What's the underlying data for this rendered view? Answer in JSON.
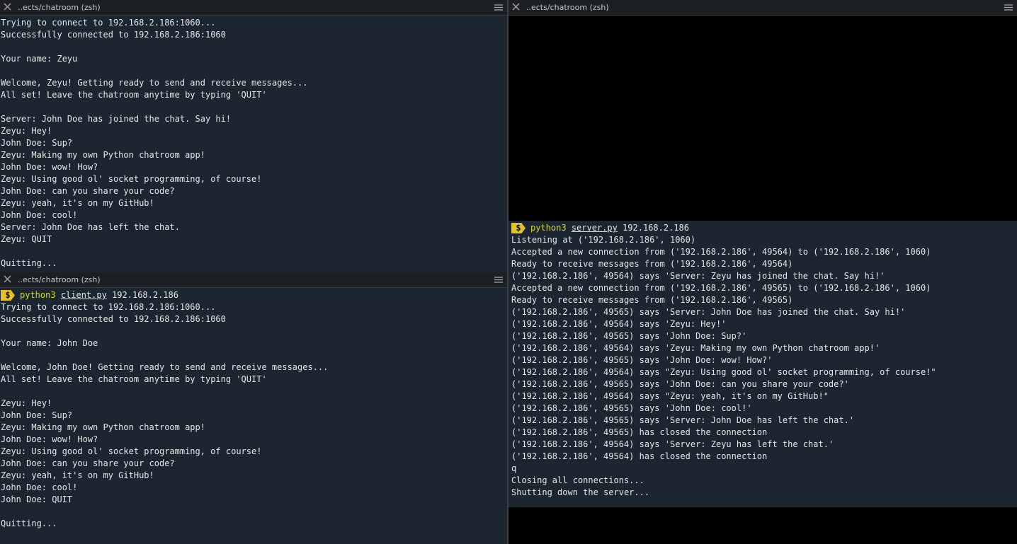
{
  "panes": {
    "top_left": {
      "title": "..ects/chatroom (zsh)",
      "lines": [
        "Trying to connect to 192.168.2.186:1060...",
        "Successfully connected to 192.168.2.186:1060",
        "",
        "Your name: Zeyu",
        "",
        "Welcome, Zeyu! Getting ready to send and receive messages...",
        "All set! Leave the chatroom anytime by typing 'QUIT'",
        "",
        "Server: John Doe has joined the chat. Say hi!",
        "Zeyu: Hey!",
        "John Doe: Sup?",
        "Zeyu: Making my own Python chatroom app!",
        "John Doe: wow! How?",
        "Zeyu: Using good ol' socket programming, of course!",
        "John Doe: can you share your code?",
        "Zeyu: yeah, it's on my GitHub!",
        "John Doe: cool!",
        "Server: John Doe has left the chat.",
        "Zeyu: QUIT",
        "",
        "Quitting..."
      ]
    },
    "bottom_left": {
      "title": "..ects/chatroom (zsh)",
      "prompt": {
        "symbol": "$",
        "command": "python3",
        "script": "client.py",
        "args": "192.168.2.186"
      },
      "lines": [
        "Trying to connect to 192.168.2.186:1060...",
        "Successfully connected to 192.168.2.186:1060",
        "",
        "Your name: John Doe",
        "",
        "Welcome, John Doe! Getting ready to send and receive messages...",
        "All set! Leave the chatroom anytime by typing 'QUIT'",
        "",
        "Zeyu: Hey!",
        "John Doe: Sup?",
        "Zeyu: Making my own Python chatroom app!",
        "John Doe: wow! How?",
        "Zeyu: Using good ol' socket programming, of course!",
        "John Doe: can you share your code?",
        "Zeyu: yeah, it's on my GitHub!",
        "John Doe: cool!",
        "John Doe: QUIT",
        "",
        "Quitting..."
      ]
    },
    "right": {
      "title": "..ects/chatroom (zsh)",
      "prompt": {
        "symbol": "$",
        "command": "python3",
        "script": "server.py",
        "args": "192.168.2.186"
      },
      "lines": [
        "Listening at ('192.168.2.186', 1060)",
        "Accepted a new connection from ('192.168.2.186', 49564) to ('192.168.2.186', 1060)",
        "Ready to receive messages from ('192.168.2.186', 49564)",
        "('192.168.2.186', 49564) says 'Server: Zeyu has joined the chat. Say hi!'",
        "Accepted a new connection from ('192.168.2.186', 49565) to ('192.168.2.186', 1060)",
        "Ready to receive messages from ('192.168.2.186', 49565)",
        "('192.168.2.186', 49565) says 'Server: John Doe has joined the chat. Say hi!'",
        "('192.168.2.186', 49564) says 'Zeyu: Hey!'",
        "('192.168.2.186', 49565) says 'John Doe: Sup?'",
        "('192.168.2.186', 49564) says 'Zeyu: Making my own Python chatroom app!'",
        "('192.168.2.186', 49565) says 'John Doe: wow! How?'",
        "('192.168.2.186', 49564) says \"Zeyu: Using good ol' socket programming, of course!\"",
        "('192.168.2.186', 49565) says 'John Doe: can you share your code?'",
        "('192.168.2.186', 49564) says \"Zeyu: yeah, it's on my GitHub!\"",
        "('192.168.2.186', 49565) says 'John Doe: cool!'",
        "('192.168.2.186', 49565) says 'Server: John Doe has left the chat.'",
        "('192.168.2.186', 49565) has closed the connection",
        "('192.168.2.186', 49564) says 'Server: Zeyu has left the chat.'",
        "('192.168.2.186', 49564) has closed the connection",
        "q",
        "Closing all connections...",
        "Shutting down the server..."
      ]
    }
  },
  "icons": {
    "close": "close-icon",
    "menu": "hamburger-menu-icon",
    "prompt": "dollar-prompt-icon"
  },
  "colors": {
    "terminal_bg": "#1b2630",
    "black_region": "#000000",
    "text": "#e6e6e6",
    "command": "#cfd82b",
    "prompt_badge": "#e2c12c"
  }
}
